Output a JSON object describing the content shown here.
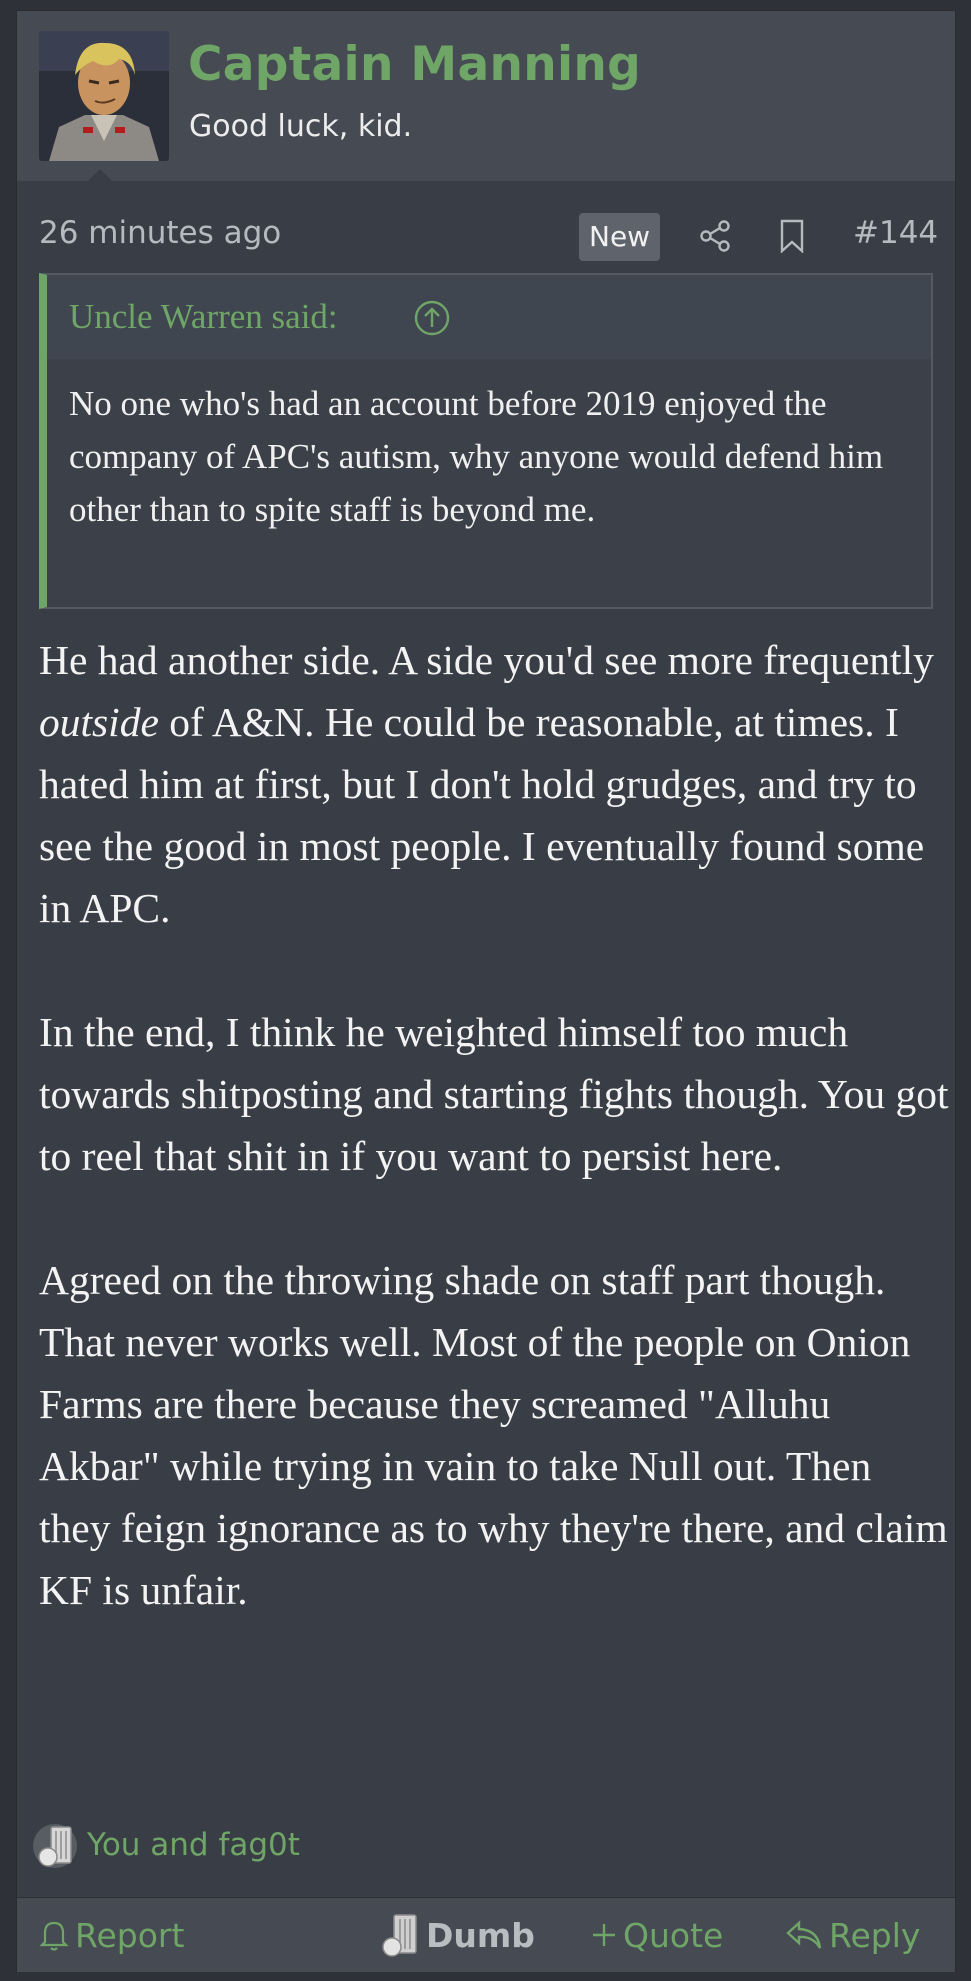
{
  "user": {
    "name": "Captain Manning",
    "title": "Good luck, kid."
  },
  "meta": {
    "time": "26 minutes ago",
    "badge": "New",
    "post_number": "#144"
  },
  "quote": {
    "author": "Uncle Warren said:",
    "text": "No one who's had an account before 2019 enjoyed the company of APC's autism, why anyone would defend him other than to spite staff is beyond me."
  },
  "body": {
    "p1_before": "He had another side. A side you'd see more frequently ",
    "p1_em": "outside",
    "p1_after": " of A&N. He could be reasonable, at times. I hated him at first, but I don't hold grudges, and try to see the good in most people. I eventually found some in APC.",
    "p2": "In the end, I think he weighted himself too much towards shitposting and starting fights though. You got to reel that shit in if you want to persist here.",
    "p3": "Agreed on the throwing shade on staff part though. That never works well. Most of the people on Onion Farms are there because they screamed \"Alluhu Akbar\" while trying in vain to take Null out. Then they feign ignorance as to why they're there, and claim KF is unfair."
  },
  "reactions": {
    "text": "You and fag0t"
  },
  "footer": {
    "report": "Report",
    "dumb": "Dumb",
    "quote": "Quote",
    "reply": "Reply"
  },
  "colors": {
    "accent": "#6fa566",
    "background": "#393d45",
    "header": "#454a53"
  },
  "icons": [
    "share-icon",
    "bookmark-icon",
    "arrow-up-circle-icon",
    "bell-icon",
    "dumb-icon",
    "plus-icon",
    "reply-icon"
  ]
}
